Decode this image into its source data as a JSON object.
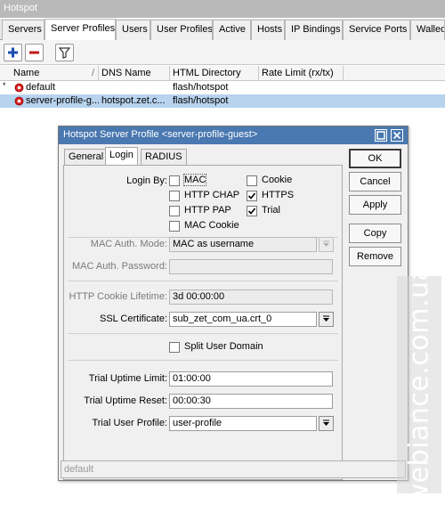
{
  "window": {
    "title": "Hotspot"
  },
  "tabs": [
    "Servers",
    "Server Profiles",
    "Users",
    "User Profiles",
    "Active",
    "Hosts",
    "IP Bindings",
    "Service Ports",
    "Walled"
  ],
  "active_tab": "Server Profiles",
  "toolbar": {
    "add_icon": "plus-icon",
    "remove_icon": "minus-icon",
    "filter_icon": "filter-icon"
  },
  "table": {
    "columns": [
      "Name",
      "DNS Name",
      "HTML Directory",
      "Rate Limit (rx/tx)"
    ],
    "sort_indicator": "/",
    "rows": [
      {
        "marker": "*",
        "name": "default",
        "dns_name": "",
        "html_directory": "flash/hotspot",
        "rate_limit": ""
      },
      {
        "marker": "",
        "name": "server-profile-g...",
        "dns_name": "hotspot.zet.c...",
        "html_directory": "flash/hotspot",
        "rate_limit": ""
      }
    ]
  },
  "dialog": {
    "title": "Hotspot Server Profile <server-profile-guest>",
    "tabs": [
      "General",
      "Login",
      "RADIUS"
    ],
    "active_tab": "Login",
    "login_by_label": "Login By:",
    "login_by": [
      {
        "label": "MAC",
        "checked": false
      },
      {
        "label": "Cookie",
        "checked": false
      },
      {
        "label": "HTTP CHAP",
        "checked": false
      },
      {
        "label": "HTTPS",
        "checked": true
      },
      {
        "label": "HTTP PAP",
        "checked": false
      },
      {
        "label": "Trial",
        "checked": true
      },
      {
        "label": "MAC Cookie",
        "checked": false
      }
    ],
    "mac_auth_mode_label": "MAC Auth. Mode:",
    "mac_auth_mode_value": "MAC as username",
    "mac_auth_password_label": "MAC Auth. Password:",
    "mac_auth_password_value": "",
    "http_cookie_lifetime_label": "HTTP Cookie Lifetime:",
    "http_cookie_lifetime_value": "3d 00:00:00",
    "ssl_certificate_label": "SSL Certificate:",
    "ssl_certificate_value": "sub_zet_com_ua.crt_0",
    "split_user_domain_label": "Split User Domain",
    "split_user_domain_checked": false,
    "trial_uptime_limit_label": "Trial Uptime Limit:",
    "trial_uptime_limit_value": "01:00:00",
    "trial_uptime_reset_label": "Trial Uptime Reset:",
    "trial_uptime_reset_value": "00:00:30",
    "trial_user_profile_label": "Trial User Profile:",
    "trial_user_profile_value": "user-profile",
    "buttons": {
      "ok": "OK",
      "cancel": "Cancel",
      "apply": "Apply",
      "copy": "Copy",
      "remove": "Remove"
    },
    "status": "default"
  },
  "watermark": "webiance.com.ua"
}
